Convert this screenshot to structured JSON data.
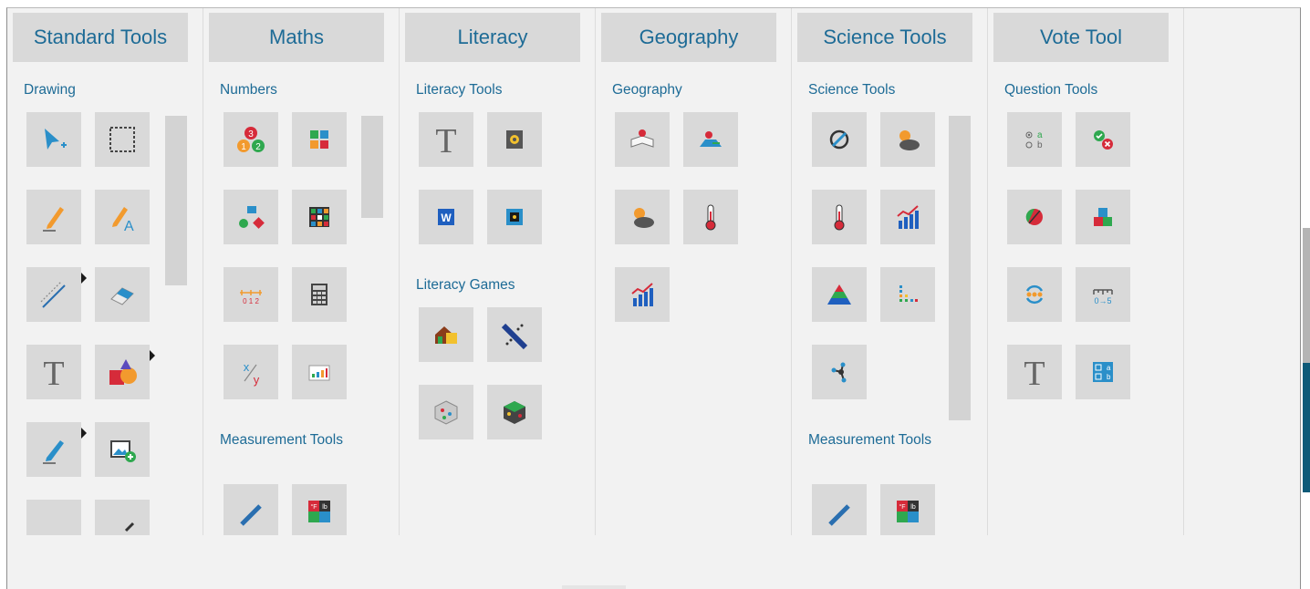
{
  "columns": [
    {
      "title": "Standard Tools",
      "groups": [
        {
          "title": "Drawing"
        }
      ]
    },
    {
      "title": "Maths",
      "groups": [
        {
          "title": "Numbers"
        },
        {
          "title": "Measurement Tools"
        }
      ]
    },
    {
      "title": "Literacy",
      "groups": [
        {
          "title": "Literacy Tools"
        },
        {
          "title": "Literacy Games"
        }
      ]
    },
    {
      "title": "Geography",
      "groups": [
        {
          "title": "Geography"
        }
      ]
    },
    {
      "title": "Science Tools",
      "groups": [
        {
          "title": "Science Tools"
        },
        {
          "title": "Measurement Tools"
        }
      ]
    },
    {
      "title": "Vote Tool",
      "groups": [
        {
          "title": "Question Tools"
        }
      ]
    }
  ],
  "icons": {
    "std": [
      "select-arrow-icon",
      "marquee-select-icon",
      "pen-icon",
      "handwriting-recognition-icon",
      "line-tool-icon",
      "eraser-icon",
      "text-tool-icon",
      "shapes-icon",
      "highlighter-icon",
      "insert-image-icon",
      "more-tool-icon",
      "more-tool-icon"
    ],
    "maths_numbers": [
      "number-bonds-icon",
      "four-operations-icon",
      "sorting-shapes-icon",
      "hundred-square-icon",
      "number-line-icon",
      "calculator-icon",
      "fractions-icon",
      "tally-chart-icon"
    ],
    "maths_measure": [
      "ruler-icon",
      "unit-converter-icon"
    ],
    "lit_tools": [
      "text-tool-icon",
      "audio-safe-icon",
      "word-document-icon",
      "locked-box-icon"
    ],
    "lit_games": [
      "word-house-icon",
      "word-search-icon",
      "letter-cube-icon",
      "dice-icon"
    ],
    "geo": [
      "map-book-icon",
      "map-pin-icon",
      "weather-icon",
      "thermometer-icon",
      "graph-icon"
    ],
    "sci_tools": [
      "compass-icon",
      "weather-icon",
      "thermometer-icon",
      "graph-icon",
      "pyramid-icon",
      "dot-chart-icon",
      "molecule-icon"
    ],
    "sci_measure": [
      "ruler-icon",
      "unit-converter-icon"
    ],
    "vote": [
      "multiple-choice-icon",
      "right-wrong-icon",
      "true-false-icon",
      "blocks-icon",
      "cycle-icon",
      "number-scale-icon",
      "text-answer-icon",
      "checkbox-answer-icon"
    ]
  },
  "glyph_text": {
    "text_tool": "T",
    "word_badge": "W",
    "mc_a": "a",
    "mc_b": "b",
    "number_scale": "0→5",
    "unit_converter": [
      "°F",
      "lb"
    ],
    "number_bonds": [
      "3",
      "1",
      "2"
    ],
    "number_line": "0 1 2",
    "fraction": [
      "x",
      "y"
    ]
  },
  "colors": {
    "accent": "#1d6b96",
    "tile": "#d9d9d9",
    "panel": "#f2f2f2",
    "header_bg": "#d9d9d9",
    "edge_blue": "#0e5a78"
  }
}
